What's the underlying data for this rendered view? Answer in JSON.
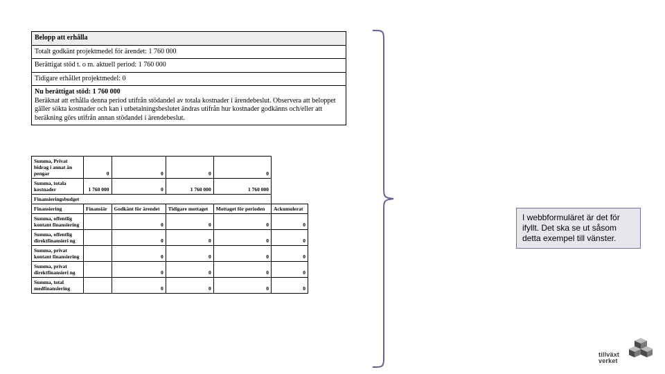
{
  "summary": {
    "title": "Belopp att erhålla",
    "lines": [
      "Totalt godkänt projektmedel för ärendet: 1 760 000",
      "Berättigat stöd t. o m. aktuell period: 1 760 000",
      "Tidigare erhållet projektmedel: 0"
    ],
    "now_title": "Nu berättigat stöd: 1 760 000",
    "explain": "Beräknat att erhålla denna period utifrån stödandel av totala kostnader i ärendebeslut. Observera att beloppet gäller sökta kostnader och kan i utbetalningsbeslutet ändras utifrån hur kostnader godkänns och/eller att beräkning görs utifrån annan stödandel i ärendebeslut."
  },
  "detail": {
    "top_rows": [
      {
        "label": "Summa, Privat bidrag i annat än pengar",
        "vals": [
          "0",
          "0",
          "0",
          "0"
        ]
      },
      {
        "label": "Summa, totala kostnader",
        "vals": [
          "1 760 000",
          "0",
          "1 760 000",
          "1 760 000"
        ]
      }
    ],
    "section_heading": "Finansieringsbudget",
    "columns": [
      "Finansiering",
      "Finansiär",
      "Godkänt för ärendet",
      "Tidigare mottaget",
      "Mottaget för perioden",
      "Ackumulerat"
    ],
    "rows": [
      {
        "label": "Summa, offentlig kontant finansiering",
        "vals": [
          "0",
          "0",
          "0",
          "0"
        ]
      },
      {
        "label": "Summa, offentlig direktfinansieri ng",
        "vals": [
          "0",
          "0",
          "0",
          "0"
        ]
      },
      {
        "label": "Summa, privat kontant finansiering",
        "vals": [
          "0",
          "0",
          "0",
          "0"
        ]
      },
      {
        "label": "Summa, privat direktfinansieri ng",
        "vals": [
          "0",
          "0",
          "0",
          "0"
        ]
      },
      {
        "label": "Summa, total medfinansiering",
        "vals": [
          "0",
          "0",
          "0",
          "0"
        ]
      }
    ]
  },
  "callout": "I webbformuläret är det för ifyllt. Det ska se ut såsom detta exempel till vänster.",
  "logo": {
    "line1": "tillväxt",
    "line2": "verket"
  },
  "colors": {
    "brace": "#6b5c98",
    "callout_border": "#7b6fa0",
    "callout_bg": "#e8e6ec",
    "logo_gray": "#4a4a4a",
    "logo_light": "#9a9a9a"
  }
}
